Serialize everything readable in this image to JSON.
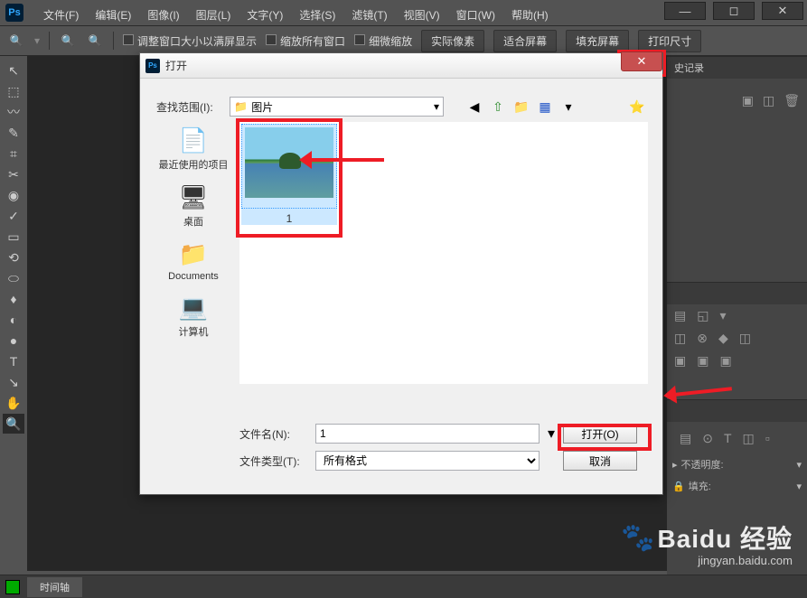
{
  "app_logo": "Ps",
  "menus": [
    "文件(F)",
    "编辑(E)",
    "图像(I)",
    "图层(L)",
    "文字(Y)",
    "选择(S)",
    "滤镜(T)",
    "视图(V)",
    "窗口(W)",
    "帮助(H)"
  ],
  "window_controls": {
    "min": "—",
    "max": "◻",
    "close": "✕"
  },
  "options_bar": {
    "resize_fit": "调整窗口大小以满屏显示",
    "zoom_all": "缩放所有窗口",
    "scrubby": "细微缩放",
    "actual": "实际像素",
    "fit_screen": "适合屏幕",
    "fill_screen": "填充屏幕",
    "print_size": "打印尺寸"
  },
  "tools": [
    "↖",
    "⬚",
    "〰",
    "✎",
    "⌗",
    "✂",
    "◉",
    "✓",
    "▭",
    "⟲",
    "⬭",
    "♦",
    "◐",
    "●",
    "T",
    "↘",
    "✋",
    "🔍"
  ],
  "panels": {
    "history": "史记录",
    "opacity": "不透明度:",
    "fill": "填充:"
  },
  "timeline": {
    "tab": "时间轴"
  },
  "dialog": {
    "title": "打开",
    "look_in_label": "查找范围(I):",
    "folder": "图片",
    "nav_icons": [
      "◀",
      "⇧",
      "📁",
      "▦",
      "▾",
      "⭐"
    ],
    "places": [
      {
        "icon": "🖥",
        "label": "最近使用的项目"
      },
      {
        "icon": "🖥",
        "label": "桌面"
      },
      {
        "icon": "📁",
        "label": "Documents"
      },
      {
        "icon": "💻",
        "label": "计算机"
      }
    ],
    "thumb_label": "1",
    "filename_label": "文件名(N):",
    "filename_value": "1",
    "filetype_label": "文件类型(T):",
    "filetype_value": "所有格式",
    "open_btn": "打开(O)",
    "cancel_btn": "取消"
  },
  "watermark": {
    "main": "Baidu 经验",
    "sub": "jingyan.baidu.com"
  }
}
